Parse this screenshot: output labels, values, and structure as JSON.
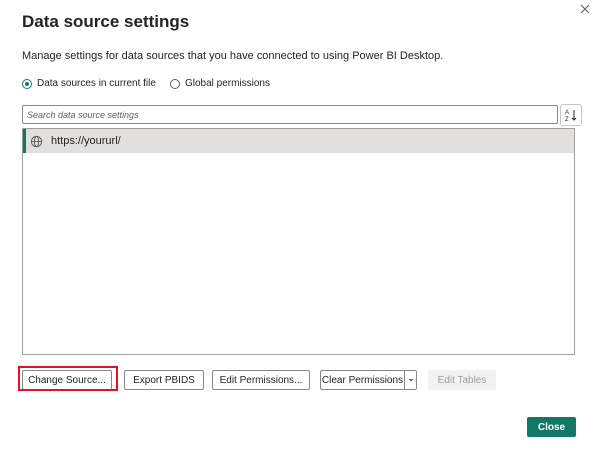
{
  "dialog": {
    "title": "Data source settings",
    "description": "Manage settings for data sources that you have connected to using Power BI Desktop."
  },
  "scope": {
    "options": [
      {
        "label": "Data sources in current file",
        "selected": true
      },
      {
        "label": "Global permissions",
        "selected": false
      }
    ]
  },
  "search": {
    "placeholder": "Search data source settings"
  },
  "sources": [
    {
      "url": "https://yoururl/",
      "icon": "globe-icon",
      "selected": true
    }
  ],
  "buttons": {
    "change_source": "Change Source...",
    "export_pbids": "Export PBIDS",
    "edit_permissions": "Edit Permissions...",
    "clear_permissions": "Clear Permissions",
    "edit_tables": "Edit Tables",
    "close": "Close"
  },
  "colors": {
    "accent": "#117865",
    "highlight": "#e81123"
  }
}
